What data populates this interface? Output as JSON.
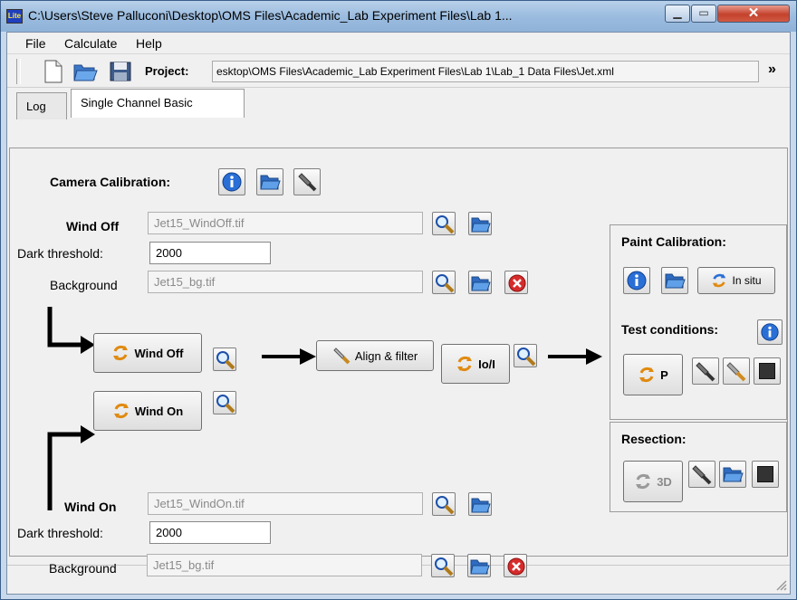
{
  "window": {
    "app_icon_text": "Lite",
    "title": "C:\\Users\\Steve Palluconi\\Desktop\\OMS Files\\Academic_Lab Experiment Files\\Lab 1..."
  },
  "menu": {
    "file": "File",
    "calculate": "Calculate",
    "help": "Help"
  },
  "toolbar": {
    "project_label": "Project:",
    "project_path": "esktop\\OMS Files\\Academic_Lab Experiment Files\\Lab 1\\Lab_1 Data Files\\Jet.xml",
    "overflow": "»"
  },
  "tabs": {
    "log": "Log",
    "single_channel": "Single Channel Basic"
  },
  "camera": {
    "label": "Camera Calibration:"
  },
  "wind_off": {
    "label": "Wind Off",
    "file": "Jet15_WindOff.tif",
    "dark_label": "Dark threshold:",
    "dark_value": "2000",
    "bg_label": "Background",
    "bg_file": "Jet15_bg.tif"
  },
  "wind_on": {
    "label": "Wind On",
    "file": "Jet15_WindOn.tif",
    "dark_label": "Dark threshold:",
    "dark_value": "2000",
    "bg_label": "Background",
    "bg_file": "Jet15_bg.tif"
  },
  "process": {
    "wind_off_btn": "Wind Off",
    "wind_on_btn": "Wind On",
    "align_btn": "Align & filter",
    "ratio_btn": "Io/I"
  },
  "paint": {
    "label": "Paint Calibration:",
    "insitu_btn": "In situ",
    "test_label": "Test conditions:",
    "p_btn": "P"
  },
  "resection": {
    "label": "Resection:",
    "btn_3d": "3D"
  }
}
